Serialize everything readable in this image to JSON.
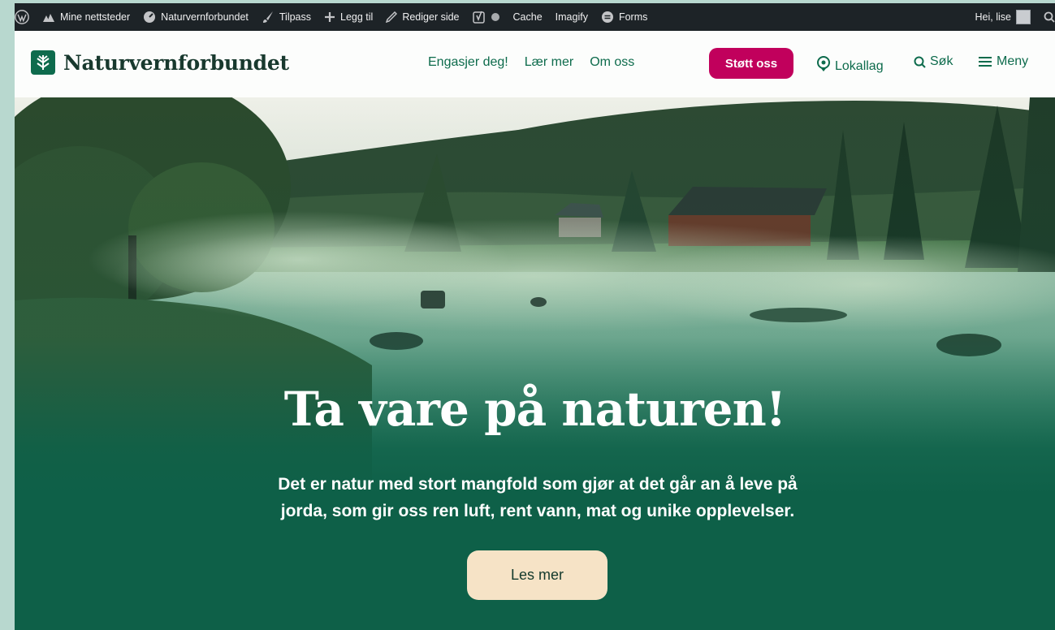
{
  "admin_bar": {
    "my_sites": "Mine nettsteder",
    "site_name": "Naturvernforbundet",
    "customize": "Tilpass",
    "add_new": "Legg til",
    "edit_page": "Rediger side",
    "cache": "Cache",
    "imagify": "Imagify",
    "forms": "Forms",
    "greeting": "Hei, lise"
  },
  "header": {
    "logo_text": "Naturvernforbundet",
    "nav": [
      "Engasjer deg!",
      "Lær mer",
      "Om oss"
    ],
    "support_label": "Støtt oss",
    "local_label": "Lokallag",
    "search_label": "Søk",
    "menu_label": "Meny"
  },
  "hero": {
    "title": "Ta vare på naturen!",
    "text_line1": "Det er natur med stort mangfold som gjør at det går an å leve på",
    "text_line2": "jorda, som gir oss ren luft, rent vann, mat og unike opplevelser.",
    "cta_label": "Les mer"
  },
  "colors": {
    "brand_green": "#0e6b4d",
    "support_magenta": "#c1005c",
    "cta_cream": "#f6e3c6",
    "admin_bar": "#1d2327"
  }
}
